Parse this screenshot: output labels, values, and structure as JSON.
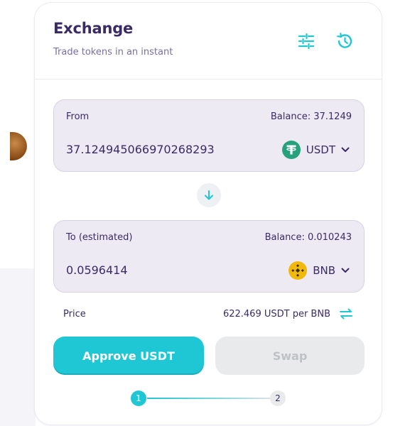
{
  "header": {
    "title": "Exchange",
    "subtitle": "Trade tokens in an instant",
    "settings_icon": "sliders-icon",
    "history_icon": "history-clock-icon"
  },
  "from": {
    "label": "From",
    "balance": "Balance: 37.1249",
    "amount": "37.124945066970268293",
    "token_symbol": "USDT",
    "token_icon": "tether-usdt-logo"
  },
  "to": {
    "label": "To (estimated)",
    "balance": "Balance: 0.010243",
    "amount": "0.0596414",
    "token_symbol": "BNB",
    "token_icon": "bnb-logo"
  },
  "direction_icon": "arrow-down-icon",
  "price": {
    "label": "Price",
    "value": "622.469 USDT per BNB",
    "toggle_icon": "swap-arrows-icon"
  },
  "actions": {
    "approve_label": "Approve USDT",
    "swap_label": "Swap"
  },
  "stepper": {
    "step1": "1",
    "step2": "2"
  },
  "colors": {
    "accent": "#1fc7d4",
    "text_primary": "#3a2b66",
    "text_secondary": "#7b6ea3",
    "input_bg": "#eeeaf4",
    "disabled_bg": "#e9eaeb",
    "disabled_text": "#bdc2c4",
    "tether_green": "#26a17b",
    "bnb_yellow": "#f0b90b"
  }
}
